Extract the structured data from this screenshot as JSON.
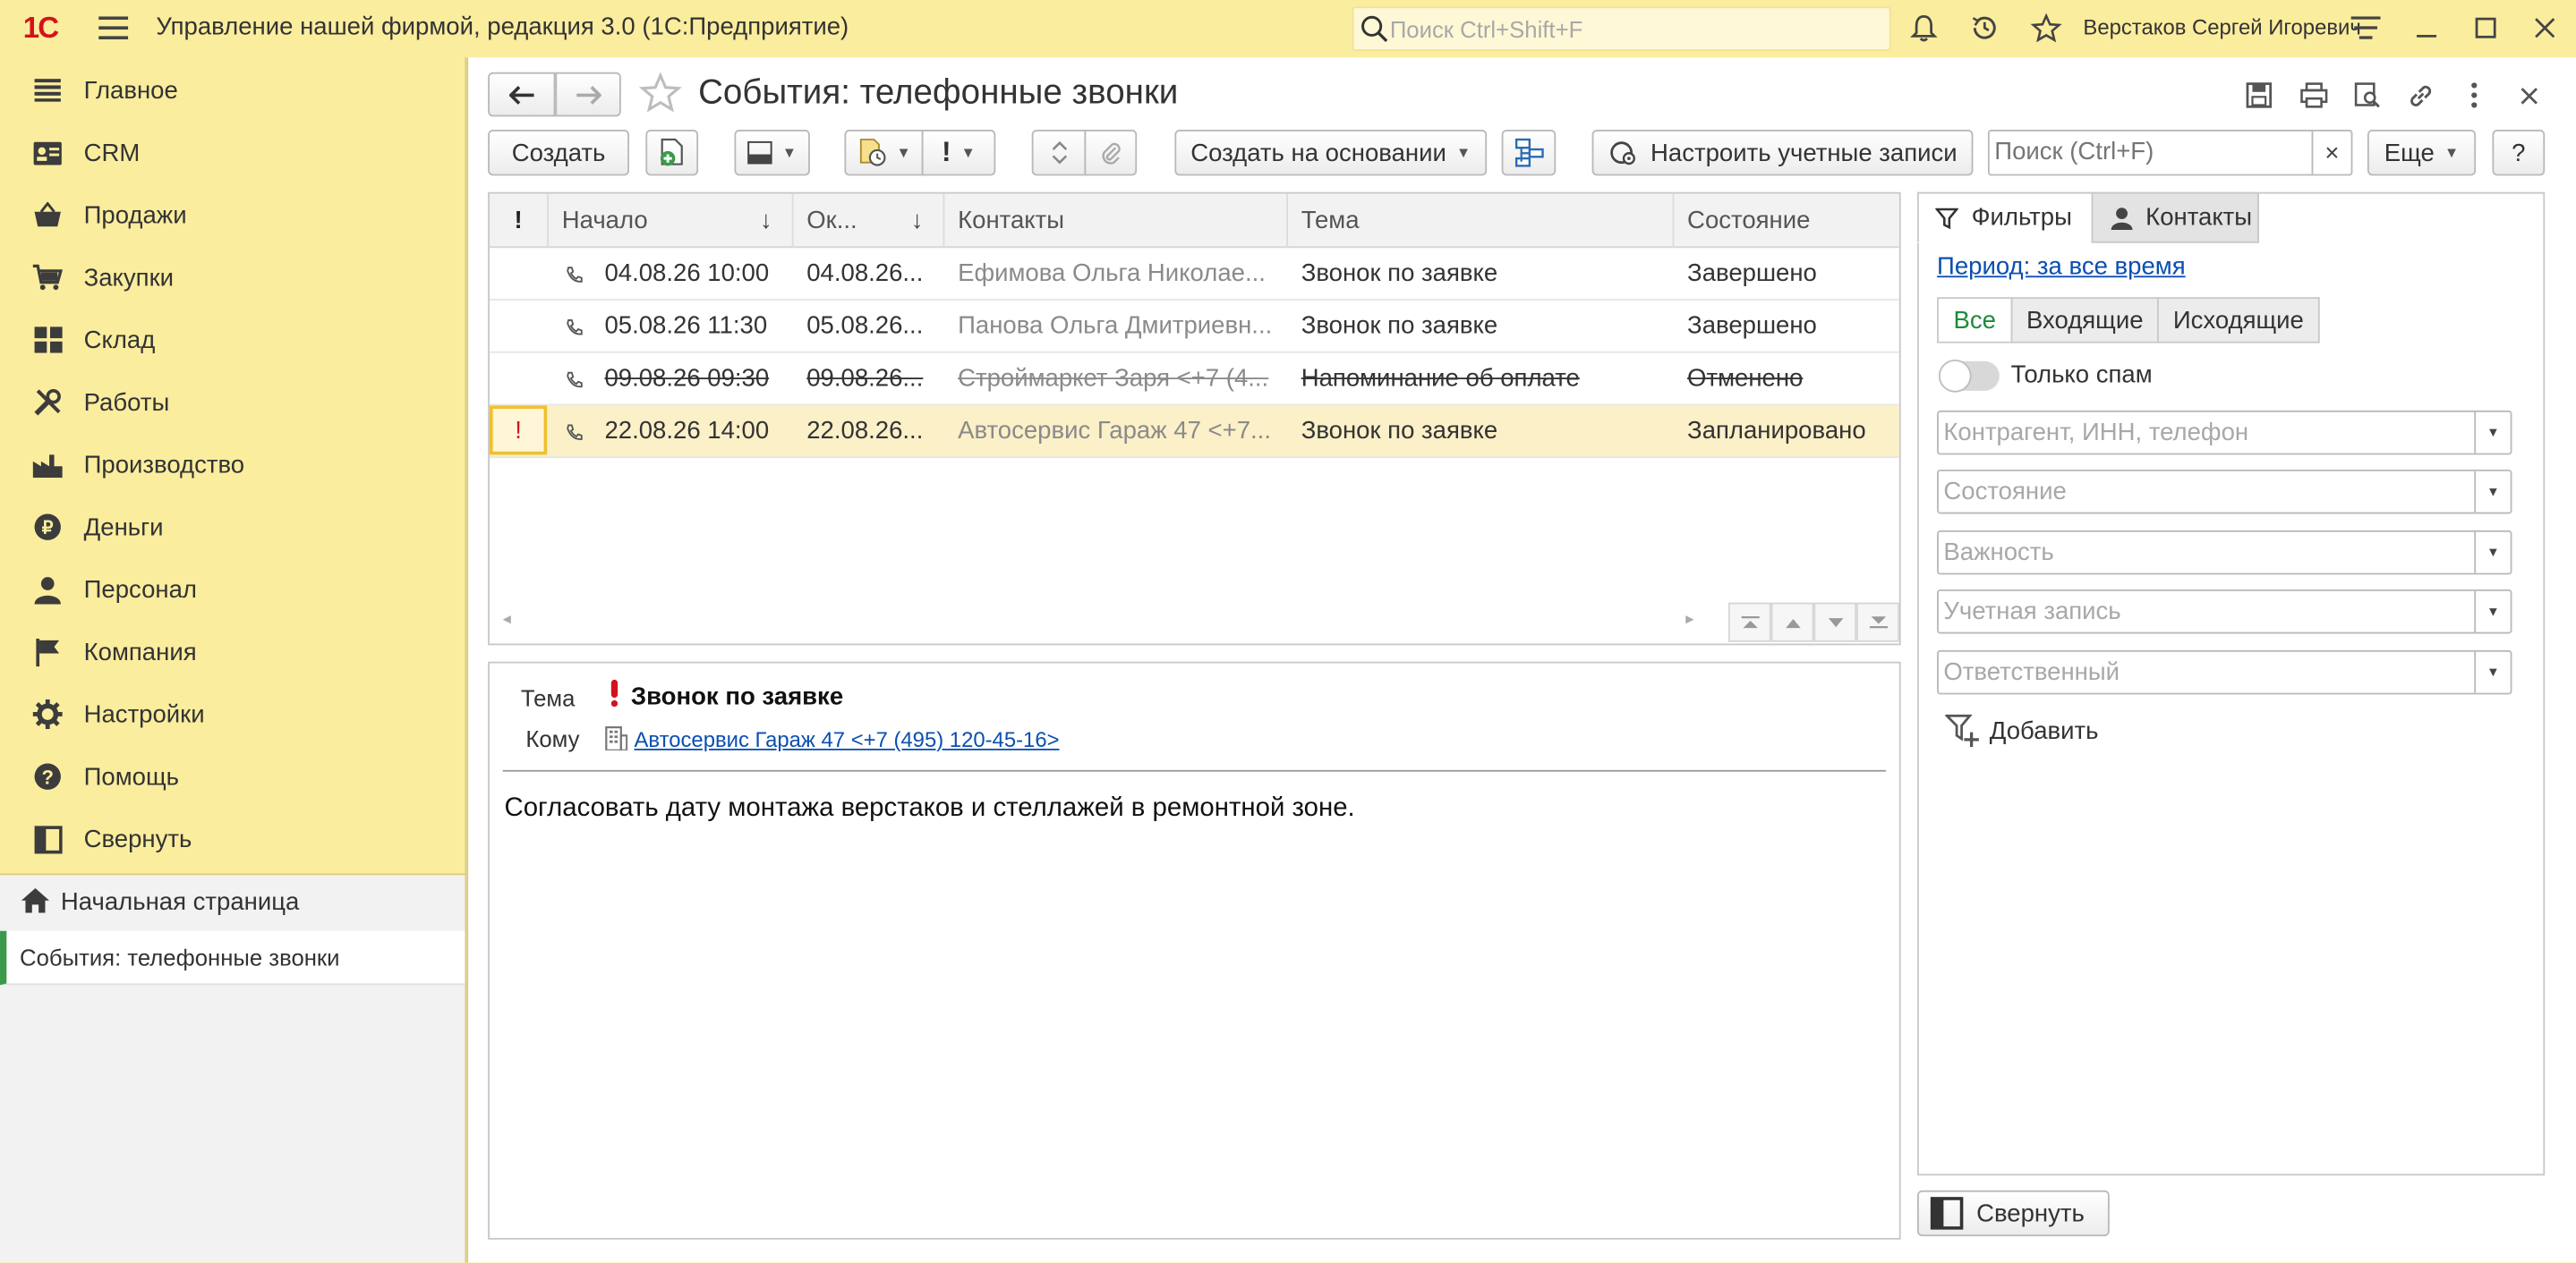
{
  "titlebar": {
    "logo": "1С",
    "app_title": "Управление нашей фирмой, редакция 3.0  (1С:Предприятие)",
    "search_placeholder": "Поиск Ctrl+Shift+F",
    "user_name": "Верстаков Сергей Игоревич"
  },
  "sidebar": {
    "items": [
      {
        "label": "Главное",
        "icon": "menu-lines-icon"
      },
      {
        "label": "CRM",
        "icon": "contacts-card-icon"
      },
      {
        "label": "Продажи",
        "icon": "basket-icon"
      },
      {
        "label": "Закупки",
        "icon": "cart-icon"
      },
      {
        "label": "Склад",
        "icon": "warehouse-grid-icon"
      },
      {
        "label": "Работы",
        "icon": "tools-icon"
      },
      {
        "label": "Производство",
        "icon": "factory-icon"
      },
      {
        "label": "Деньги",
        "icon": "ruble-coin-icon"
      },
      {
        "label": "Персонал",
        "icon": "person-icon"
      },
      {
        "label": "Компания",
        "icon": "flag-icon"
      },
      {
        "label": "Настройки",
        "icon": "gear-icon"
      },
      {
        "label": "Помощь",
        "icon": "question-icon"
      },
      {
        "label": "Свернуть",
        "icon": "collapse-panel-icon"
      }
    ],
    "open_windows": {
      "home": "Начальная страница",
      "current": "События: телефонные звонки"
    }
  },
  "page": {
    "title": "События: телефонные звонки"
  },
  "toolbar": {
    "create": "Создать",
    "create_based_on": "Создать на основании",
    "setup_accounts": "Настроить учетные записи",
    "search_placeholder": "Поиск (Ctrl+F)",
    "clear": "×",
    "more": "Еще",
    "help": "?",
    "importance": "!"
  },
  "table": {
    "columns": {
      "importance": "!",
      "start": "Начало",
      "end": "Ок...",
      "contacts": "Контакты",
      "subject": "Тема",
      "state": "Состояние"
    },
    "rows": [
      {
        "importance": "",
        "start": "04.08.26 10:00",
        "end": "04.08.26...",
        "contacts": "Ефимова Ольга Николае...",
        "subject": "Звонок по заявке",
        "state": "Завершено"
      },
      {
        "importance": "",
        "start": "05.08.26 11:30",
        "end": "05.08.26...",
        "contacts": "Панова Ольга Дмитриевн...",
        "subject": "Звонок по заявке",
        "state": "Завершено"
      },
      {
        "importance": "",
        "start": "09.08.26 09:30",
        "end": "09.08.26...",
        "contacts": "Строймаркет Заря <+7 (4...",
        "subject": "Напоминание об оплате",
        "state": "Отменено"
      },
      {
        "importance": "!",
        "start": "22.08.26 14:00",
        "end": "22.08.26...",
        "contacts": "Автосервис Гараж 47 <+7...",
        "subject": "Звонок по заявке",
        "state": "Запланировано"
      }
    ]
  },
  "preview": {
    "subject_label": "Тема",
    "subject_value": "Звонок по заявке",
    "to_label": "Кому",
    "to_value": "Автосервис Гараж 47 <+7 (495) 120-45-16>",
    "body": "Согласовать дату монтажа верстаков и стеллажей в ремонтной зоне."
  },
  "right_panel": {
    "tabs": {
      "filters": "Фильтры",
      "contacts": "Контакты"
    },
    "period": "Период: за все время",
    "direction": [
      "Все",
      "Входящие",
      "Исходящие"
    ],
    "spam_only": "Только спам",
    "fields": [
      "Контрагент, ИНН, телефон",
      "Состояние",
      "Важность",
      "Учетная запись",
      "Ответственный"
    ],
    "add_filter": "Добавить",
    "collapse": "Свернуть"
  },
  "colors": {
    "panel_yellow": "#fbed9e",
    "accent_green": "#3a9a4a",
    "logo_red": "#d5121c",
    "link_blue": "#0b4fb0",
    "selected_row": "#fbf0c8"
  }
}
